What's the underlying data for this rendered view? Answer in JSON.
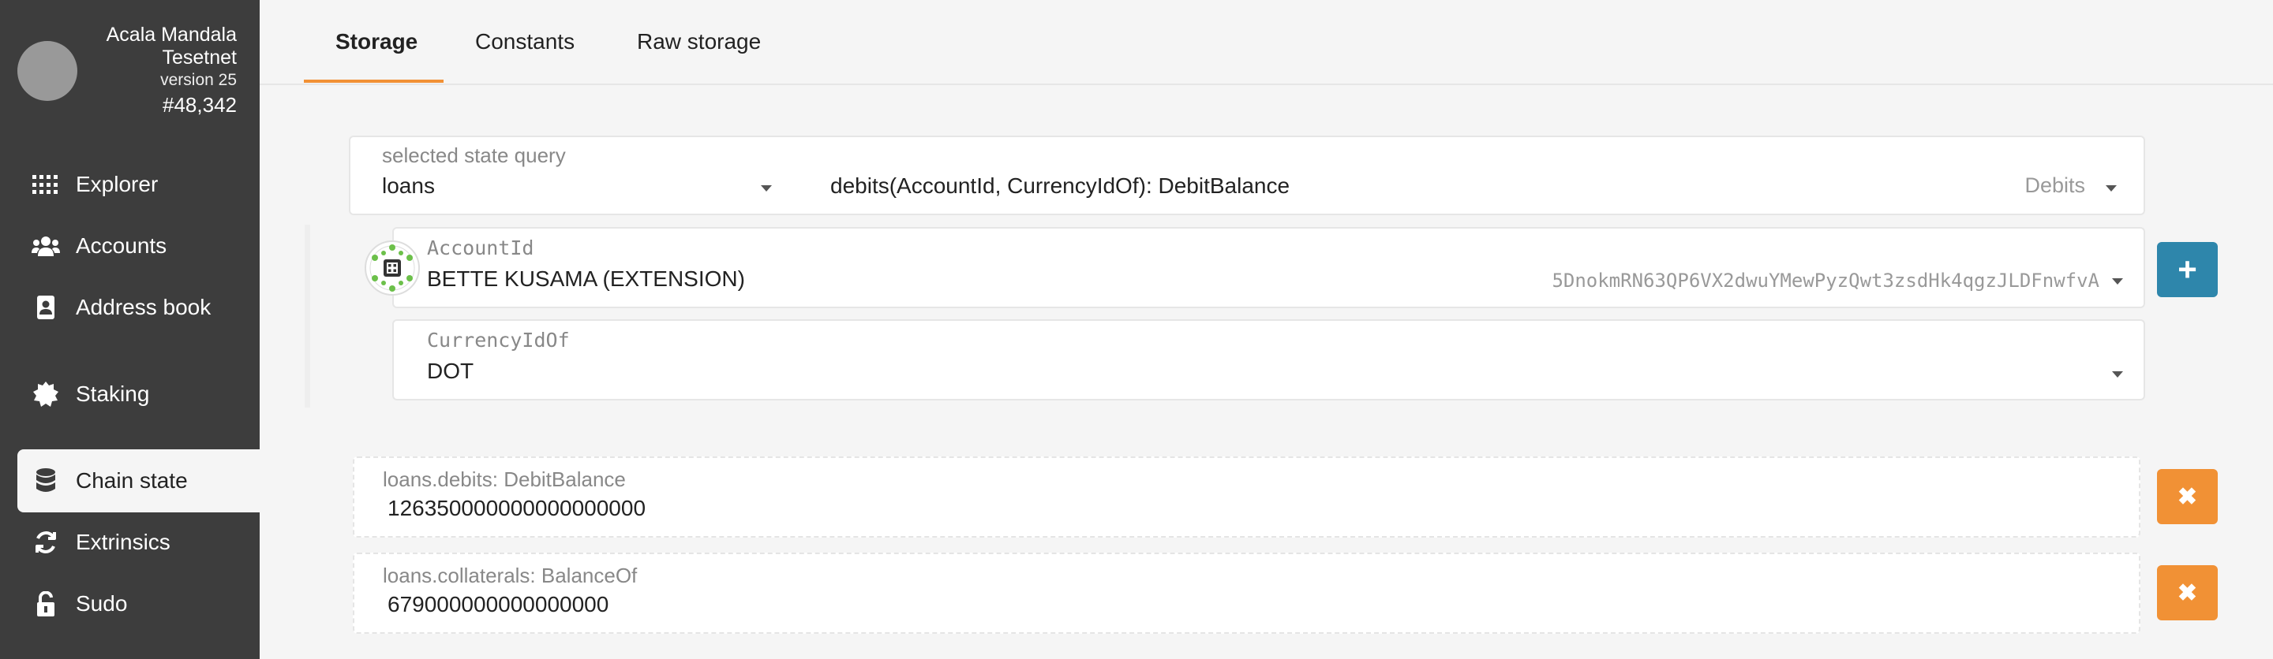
{
  "chain": {
    "name": "Acala Mandala Tesetnet",
    "version": "version 25",
    "block": "#48,342"
  },
  "sidebar": {
    "items": [
      {
        "label": "Explorer",
        "icon": "grid-dots-icon"
      },
      {
        "label": "Accounts",
        "icon": "users-icon"
      },
      {
        "label": "Address book",
        "icon": "address-book-icon"
      },
      {
        "label": "Staking",
        "icon": "certificate-icon"
      },
      {
        "label": "Chain state",
        "icon": "database-icon"
      },
      {
        "label": "Extrinsics",
        "icon": "sync-icon"
      },
      {
        "label": "Sudo",
        "icon": "unlock-icon"
      }
    ],
    "active": "Chain state"
  },
  "tabs": [
    {
      "label": "Storage",
      "active": true
    },
    {
      "label": "Constants",
      "active": false
    },
    {
      "label": "Raw storage",
      "active": false
    }
  ],
  "query": {
    "label": "selected state query",
    "module": "loans",
    "method": "debits(AccountId, CurrencyIdOf): DebitBalance",
    "method_hint": "Debits"
  },
  "params": {
    "account": {
      "label": "AccountId",
      "name": "BETTE KUSAMA (EXTENSION)",
      "address": "5DnokmRN63QP6VX2dwuYMewPyzQwt3zsdHk4qgzJLDFnwfvA"
    },
    "currency": {
      "label": "CurrencyIdOf",
      "value": "DOT"
    }
  },
  "add_button": {
    "label": "+"
  },
  "results": [
    {
      "label": "loans.debits: DebitBalance",
      "value": "126350000000000000000"
    },
    {
      "label": "loans.collaterals: BalanceOf",
      "value": "679000000000000000"
    }
  ],
  "remove_button": {
    "label": "✖"
  },
  "colors": {
    "sidebar_bg": "#3d3d3d",
    "accent": "#f19135",
    "add_button": "#2e86ab",
    "remove_button": "#f19135"
  }
}
